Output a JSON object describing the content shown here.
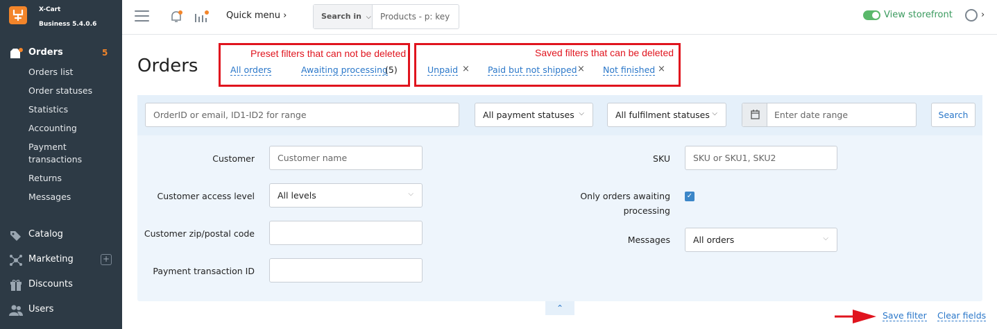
{
  "brand": {
    "name": "X-Cart",
    "version": "Business 5.4.0.6"
  },
  "sidebar": {
    "orders": {
      "label": "Orders",
      "count": "5"
    },
    "order_items": [
      "Orders list",
      "Order statuses",
      "Statistics",
      "Accounting",
      "Payment",
      "transactions",
      "Returns",
      "Messages"
    ],
    "catalog": "Catalog",
    "marketing": "Marketing",
    "marketing_plus": "+",
    "discounts": "Discounts",
    "users": "Users"
  },
  "topbar": {
    "quick_menu": "Quick menu ›",
    "search_in": "Search in",
    "search_placeholder": "Products - p: key",
    "view_storefront": "View storefront",
    "user_chevron": "›"
  },
  "page": {
    "title": "Orders"
  },
  "annotations": {
    "preset_note": "Preset filters that can not be deleted",
    "saved_note": "Saved filters that can be deleted"
  },
  "preset_filters": {
    "all_orders": "All orders",
    "awaiting": "Awaiting processing",
    "awaiting_count": "(5)"
  },
  "saved_filters": {
    "unpaid": "Unpaid",
    "paid_not_shipped": "Paid but not shipped",
    "not_finished": "Not finished",
    "remove": "×"
  },
  "filters": {
    "order_placeholder": "OrderID or email, ID1-ID2 for range",
    "payment_status": "All payment statuses",
    "fulfilment_status": "All fulfilment statuses",
    "date_placeholder": "Enter date range",
    "search_button": "Search",
    "customer_label": "Customer",
    "customer_placeholder": "Customer name",
    "access_label": "Customer access level",
    "access_value": "All levels",
    "zip_label": "Customer zip/postal code",
    "txn_label": "Payment transaction ID",
    "sku_label": "SKU",
    "sku_placeholder": "SKU or SKU1, SKU2",
    "awaiting_label_1": "Only orders awaiting",
    "awaiting_label_2": "processing",
    "awaiting_checked": "✓",
    "messages_label": "Messages",
    "messages_value": "All orders"
  },
  "bottom": {
    "collapse": "⌃",
    "save_filter": "Save filter",
    "clear_fields": "Clear fields"
  },
  "colors": {
    "sidebar_bg": "#2d3a45",
    "accent": "#f3852a",
    "link": "#2a77c9",
    "annotation_red": "#e0141e",
    "storefront_green": "#3a9a5e"
  }
}
